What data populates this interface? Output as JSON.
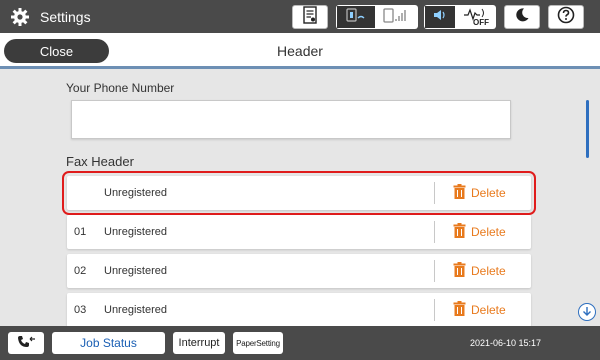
{
  "topbar": {
    "title": "Settings",
    "icons": {
      "settings": "gear-icon",
      "job_history": "document-icon",
      "network": "wireless-network-icon",
      "sound": "speaker-icon",
      "quiet": "quiet-mode-icon",
      "quiet_off_label": "OFF",
      "night": "moon-icon",
      "help": "help-icon"
    }
  },
  "header": {
    "close_label": "Close",
    "title": "Header"
  },
  "phone": {
    "label": "Your Phone Number",
    "value": ""
  },
  "fax_header": {
    "label": "Fax Header",
    "rows": [
      {
        "number": "",
        "status": "Unregistered",
        "delete_label": "Delete",
        "selected": true
      },
      {
        "number": "01",
        "status": "Unregistered",
        "delete_label": "Delete",
        "selected": false
      },
      {
        "number": "02",
        "status": "Unregistered",
        "delete_label": "Delete",
        "selected": false
      },
      {
        "number": "03",
        "status": "Unregistered",
        "delete_label": "Delete",
        "selected": false
      }
    ]
  },
  "bottombar": {
    "fax_icon": "fax-call-icon",
    "job_status_label": "Job Status",
    "interrupt_label": "Interrupt",
    "paper_setting_label": "PaperSetting",
    "datetime": "2021-06-10 15:17"
  },
  "colors": {
    "accent_orange": "#e87a1d",
    "selection_red": "#e01c1c",
    "link_blue": "#1a5fb4",
    "bar_dark": "#4a4a4a"
  }
}
